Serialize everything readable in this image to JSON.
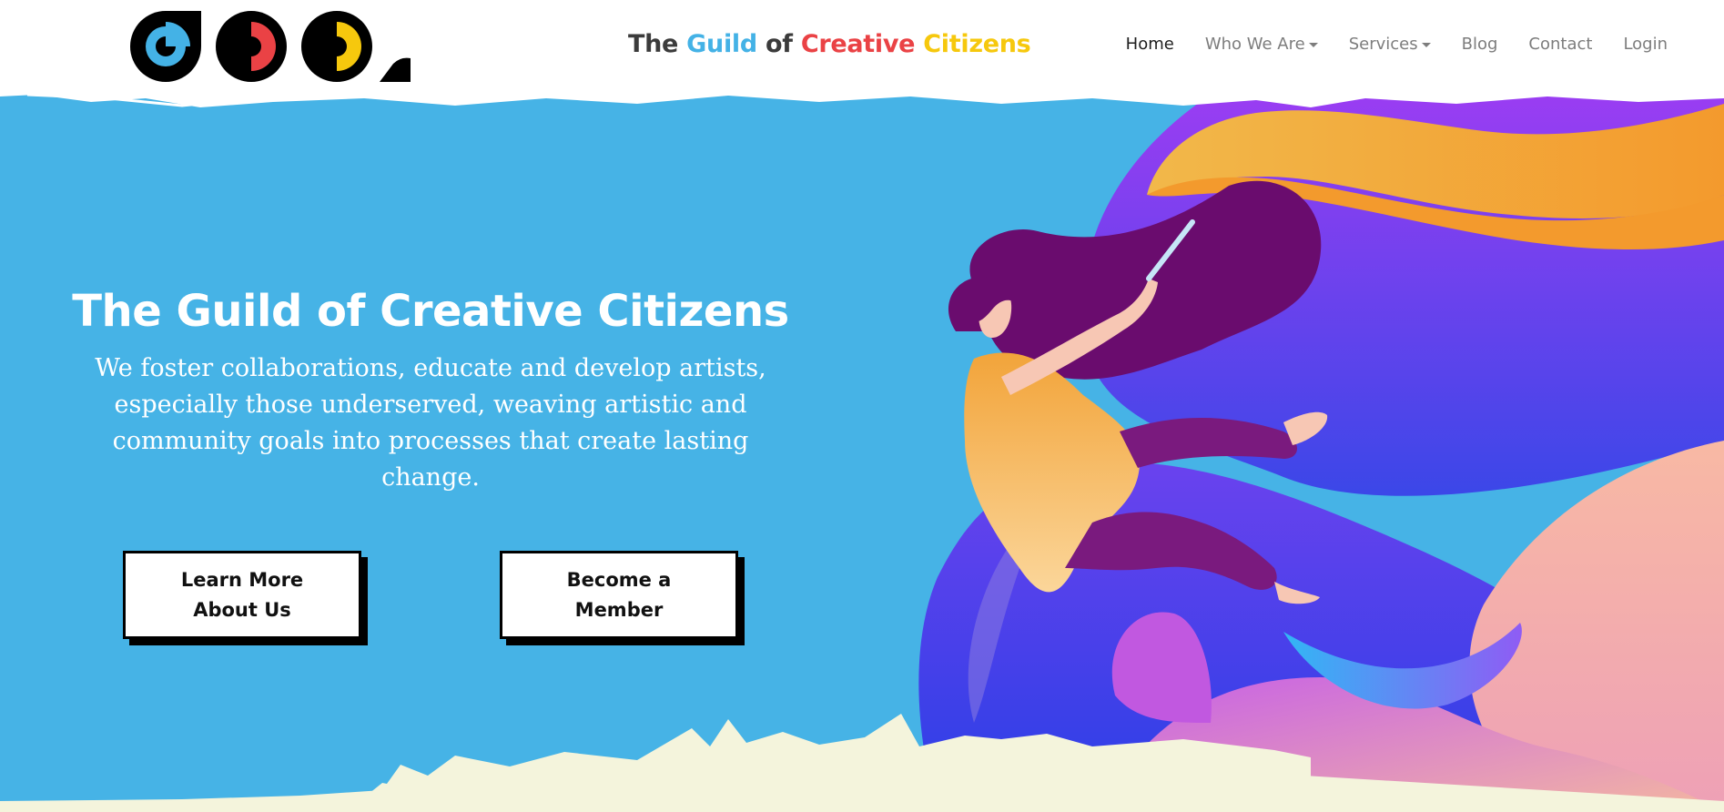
{
  "header": {
    "logo_alt": "GCC",
    "title": {
      "the": "The",
      "guild": "Guild",
      "of": "of",
      "creative": "Creative",
      "citizens": "Citizens"
    },
    "nav": [
      {
        "label": "Home",
        "active": true,
        "dropdown": false
      },
      {
        "label": "Who We Are",
        "active": false,
        "dropdown": true
      },
      {
        "label": "Services",
        "active": false,
        "dropdown": true
      },
      {
        "label": "Blog",
        "active": false,
        "dropdown": false
      },
      {
        "label": "Contact",
        "active": false,
        "dropdown": false
      },
      {
        "label": "Login",
        "active": false,
        "dropdown": false
      }
    ]
  },
  "hero": {
    "title": "The Guild of Creative Citizens",
    "subtitle": "We foster collaborations, educate and develop artists, especially those underserved, weaving artistic and community goals into processes that create lasting change.",
    "buttons": {
      "learn_more": "Learn More About Us",
      "become_member": "Become a Member"
    }
  },
  "colors": {
    "hero_bg": "#46b3e6",
    "brand_blue": "#44b2e6",
    "brand_red": "#ea4245",
    "brand_yellow": "#f6c80d",
    "brush_cream": "#f4f4dc",
    "illustration_purple": "#8a3ff0",
    "illustration_orange": "#f2a93a"
  },
  "icons": {
    "logo": "gcc-logo-icon",
    "dropdown": "caret-down-icon",
    "illustration": "woman-painting-illustration"
  }
}
